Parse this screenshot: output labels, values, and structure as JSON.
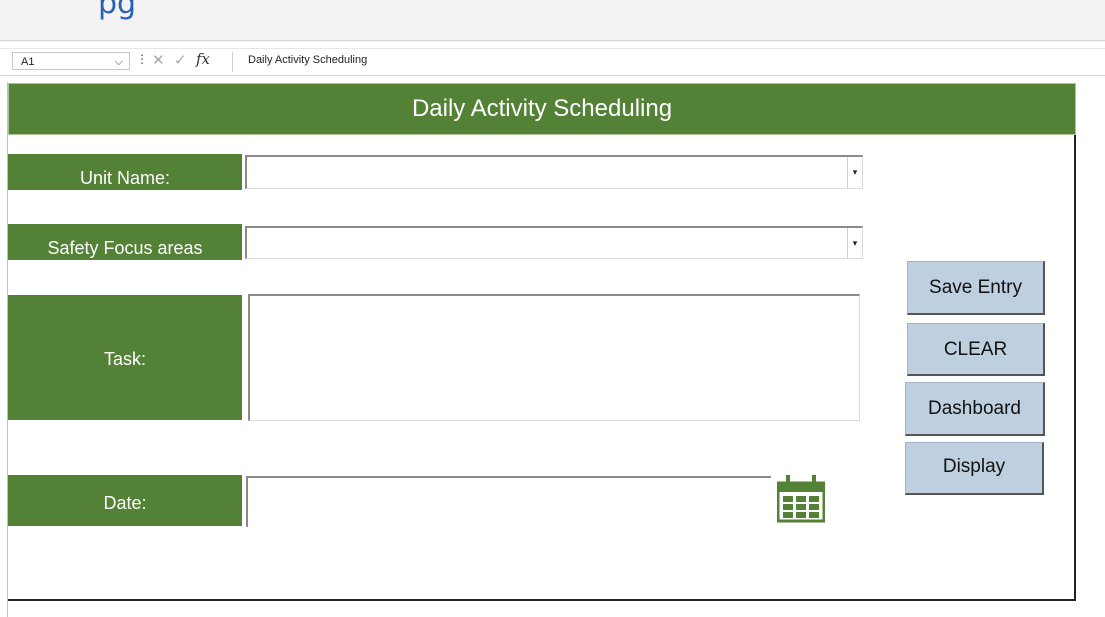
{
  "window": {
    "clipped_title": "pg"
  },
  "formula_bar": {
    "cell_ref": "A1",
    "dots": "⋮",
    "cancel_glyph": "✕",
    "enter_glyph": "✓",
    "fx_label": "fx",
    "content": "Daily Activity Scheduling"
  },
  "form": {
    "title": "Daily Activity Scheduling",
    "fields": {
      "unit_name": {
        "label": "Unit Name:",
        "value": ""
      },
      "safety_focus": {
        "label": "Safety Focus areas",
        "value": ""
      },
      "task": {
        "label": "Task:",
        "value": ""
      },
      "date": {
        "label": "Date:",
        "value": ""
      }
    },
    "buttons": {
      "save": "Save Entry",
      "clear": "CLEAR",
      "dashboard": "Dashboard",
      "display": "Display"
    }
  },
  "icons": {
    "dropdown": "▾",
    "chevron": "⌵",
    "calendar": "calendar-icon"
  },
  "colors": {
    "accent_green": "#538135",
    "button_blue": "#bed0e0"
  }
}
